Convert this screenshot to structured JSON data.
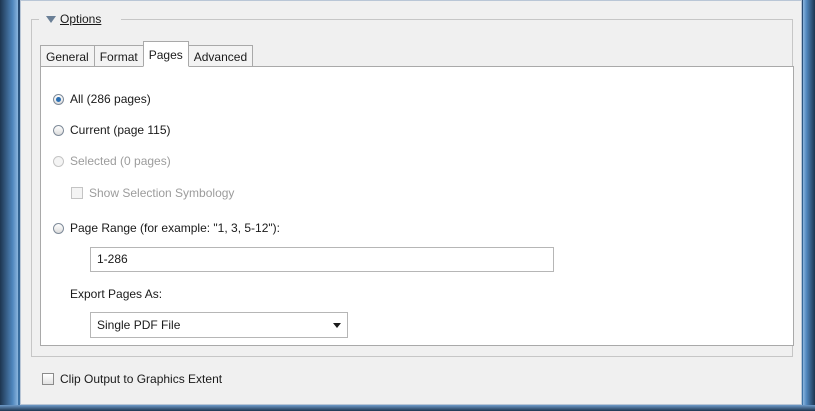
{
  "group": {
    "title": "Options"
  },
  "tabs": [
    {
      "label": "General"
    },
    {
      "label": "Format"
    },
    {
      "label": "Pages"
    },
    {
      "label": "Advanced"
    }
  ],
  "pages": {
    "all_label": "All (286 pages)",
    "current_label": "Current (page 115)",
    "selected_label": "Selected (0 pages)",
    "show_selection_label": "Show Selection Symbology",
    "range_label": "Page Range (for example: \"1, 3, 5-12\"):",
    "range_value": "1-286",
    "export_as_label": "Export Pages As:",
    "export_as_value": "Single PDF File"
  },
  "clip": {
    "label": "Clip Output to Graphics Extent"
  }
}
